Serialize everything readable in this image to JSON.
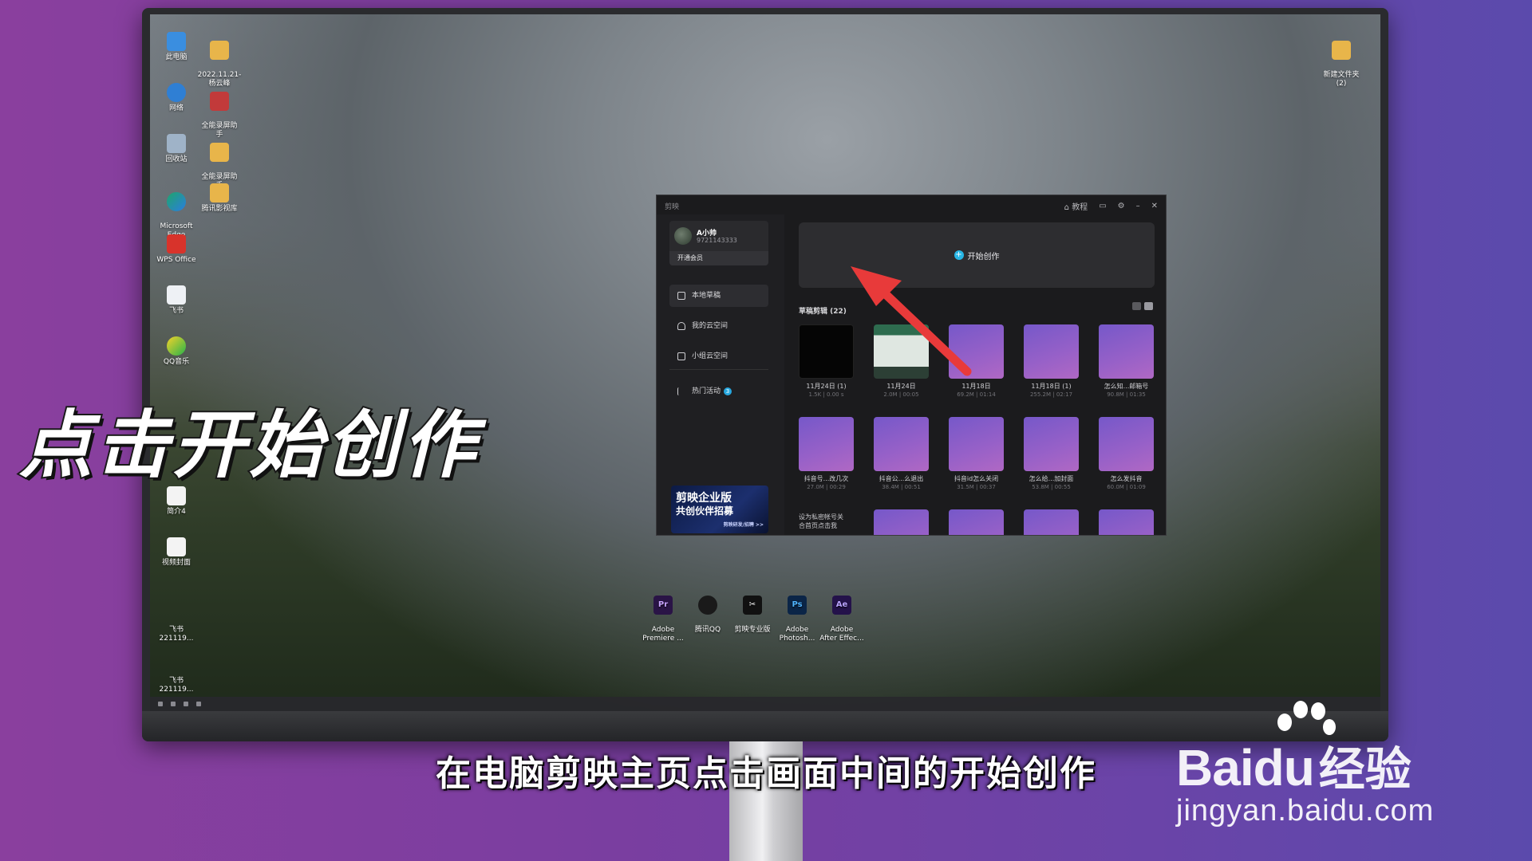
{
  "desktop_icons": {
    "this_pc": "此电脑",
    "folder_2022": "2022.11.21-\n杨云峰",
    "network": "网络",
    "recorder_a": "全能录屏助\n手",
    "recycle": "回收站",
    "recorder_b": "全能录屏助\n手",
    "edge": "Microsoft\nEdge",
    "tencent_video": "腾讯影视库",
    "wps": "WPS Office",
    "feishu": "飞书",
    "qqmusic": "QQ音乐",
    "intro4": "简介4",
    "video_cover": "视频封面",
    "feishu_a": "飞书\n221119...",
    "feishu_b": "飞书\n221119...",
    "new_folder": "新建文件夹\n(2)"
  },
  "pinned_apps": [
    {
      "label": "Adobe\nPremiere ...",
      "glyph": "Pr",
      "color": "#2a1446"
    },
    {
      "label": "腾讯QQ",
      "glyph": "",
      "color": "#1a1a1a"
    },
    {
      "label": "剪映专业版",
      "glyph": "",
      "color": "#111111"
    },
    {
      "label": "Adobe\nPhotosh...",
      "glyph": "Ps",
      "color": "#0b2547"
    },
    {
      "label": "Adobe\nAfter Effec...",
      "glyph": "Ae",
      "color": "#24124a"
    }
  ],
  "app": {
    "title": "剪映",
    "tutorial": "教程",
    "profile": {
      "name": "A小帅",
      "uid": "9721143333",
      "vip": "开通会员"
    },
    "nav": {
      "local_drafts": "本地草稿",
      "my_cloud": "我的云空间",
      "team_cloud": "小组云空间",
      "hot_events": "热门活动",
      "hot_badge": "3"
    },
    "promo": {
      "line1": "剪映企业版",
      "line2": "共创伙伴招募",
      "line3": "剪映研发/招聘 >>"
    },
    "create_label": "开始创作",
    "drafts_title": "草稿剪辑 (22)",
    "drafts_row1": [
      {
        "title": "11月24日 (1)",
        "meta": "1.5K | 0.00 s"
      },
      {
        "title": "11月24日",
        "meta": "2.0M | 00:05"
      },
      {
        "title": "11月18日",
        "meta": "69.2M | 01:14"
      },
      {
        "title": "11月18日 (1)",
        "meta": "255.2M | 02:17"
      },
      {
        "title": "怎么知...邮箱号",
        "meta": "90.8M | 01:35"
      }
    ],
    "drafts_row2": [
      {
        "title": "抖音号...改几次",
        "meta": "27.0M | 00:29"
      },
      {
        "title": "抖音公...么退出",
        "meta": "38.4M | 00:51"
      },
      {
        "title": "抖音id怎么关闭",
        "meta": "31.5M | 00:37"
      },
      {
        "title": "怎么给...加封面",
        "meta": "53.8M | 00:55"
      },
      {
        "title": "怎么发抖音",
        "meta": "60.0M | 01:09"
      }
    ],
    "row3_label": "设为私密帐号关\n合首页点击我"
  },
  "overlay": {
    "big_caption": "点击开始创作",
    "subtitle": "在电脑剪映主页点击画面中间的开始创作",
    "watermark_brand": "Bai",
    "watermark_brand2": "经验",
    "watermark_url": "jingyan.baidu.com"
  },
  "colors": {
    "accent": "#27b6e6",
    "arrow": "#e83a3a",
    "background": "#7a3ea0"
  }
}
